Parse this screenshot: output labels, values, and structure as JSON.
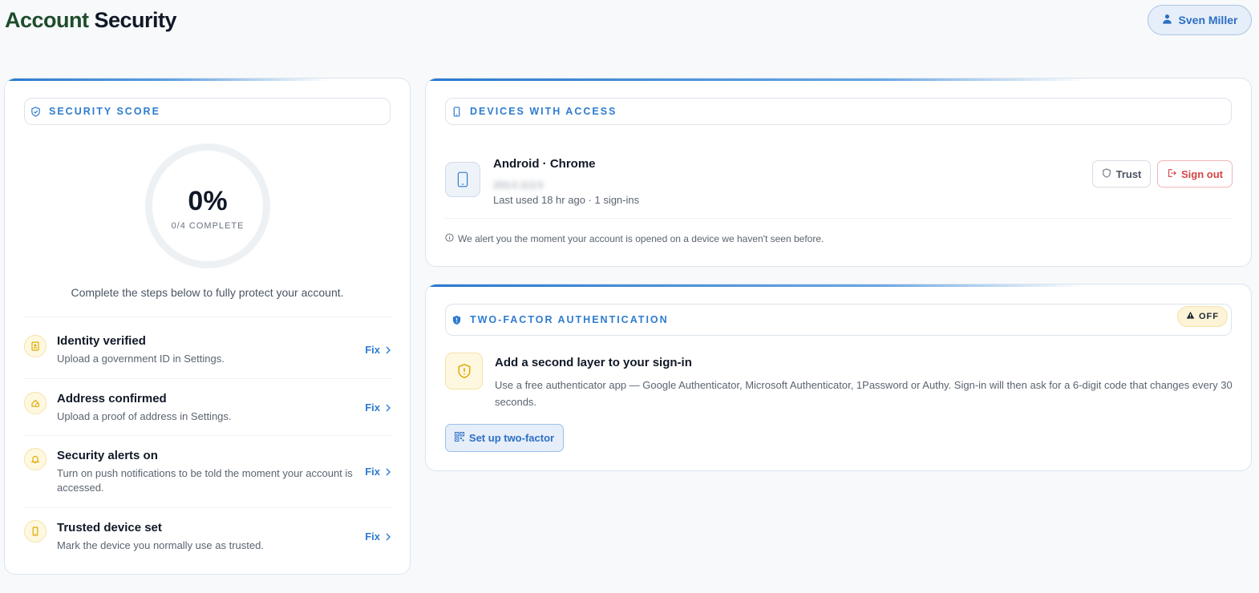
{
  "page": {
    "title_part1": "Account",
    "title_part2": "Security"
  },
  "user": {
    "name": "Sven Miller",
    "icon": "user-icon"
  },
  "score": {
    "section_label": "SECURITY SCORE",
    "percent": "0%",
    "complete": "0/4 COMPLETE",
    "progress_fraction": 0,
    "hint": "Complete the steps below to fully protect your account.",
    "steps": [
      {
        "title": "Identity verified",
        "desc": "Upload a government ID in Settings.",
        "action": "Fix",
        "icon": "id-card-icon"
      },
      {
        "title": "Address confirmed",
        "desc": "Upload a proof of address in Settings.",
        "action": "Fix",
        "icon": "home-check-icon"
      },
      {
        "title": "Security alerts on",
        "desc": "Turn on push notifications to be told the moment your account is accessed.",
        "action": "Fix",
        "icon": "bell-icon"
      },
      {
        "title": "Trusted device set",
        "desc": "Mark the device you normally use as trusted.",
        "action": "Fix",
        "icon": "phone-icon"
      }
    ]
  },
  "devices": {
    "section_label": "DEVICES WITH ACCESS",
    "device": {
      "name": "Android · Chrome",
      "ip": "203.0.113.5",
      "last_used": "Last used 18 hr ago · 1 sign-ins",
      "trust_label": "Trust",
      "signout_label": "Sign out"
    },
    "note": "We alert you the moment your account is opened on a device we haven't seen before."
  },
  "two_factor": {
    "section_label": "TWO-FACTOR AUTHENTICATION",
    "status": "OFF",
    "title": "Add a second layer to your sign-in",
    "desc": "Use a free authenticator app — Google Authenticator, Microsoft Authenticator, 1Password or Authy. Sign-in will then ask for a 6-digit code that changes every 30 seconds.",
    "setup_label": "Set up two-factor"
  },
  "colors": {
    "accent": "#2e7ccf",
    "danger": "#d64545",
    "warning_bg": "#fff8e1",
    "title_green": "#1e4d2b"
  }
}
